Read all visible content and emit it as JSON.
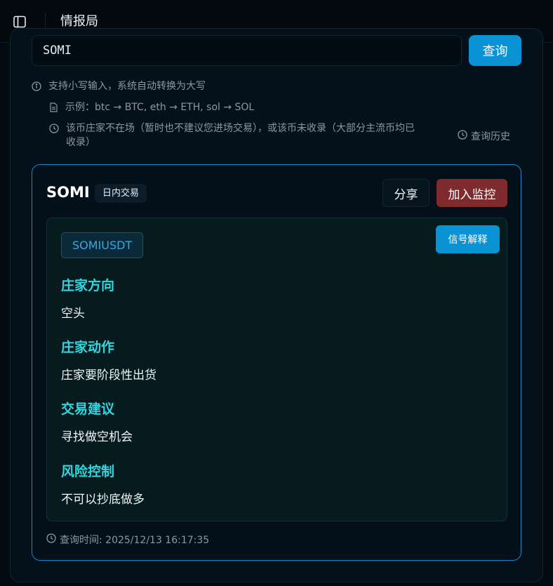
{
  "header": {
    "title": "情报局"
  },
  "search": {
    "value": "SOMI",
    "button_label": "查询"
  },
  "hints": [
    {
      "icon": "info-icon",
      "text": "支持小写输入，系统自动转换为大写"
    },
    {
      "icon": "document-icon",
      "text": "示例：btc → BTC, eth → ETH, sol → SOL"
    },
    {
      "icon": "clock-icon",
      "text_line1": "该币庄家不在场（暂时也不建议您进场交易），或该币未收录（大部分主流币均已",
      "text_line2": "收录）"
    }
  ],
  "history_label": "查询历史",
  "result": {
    "coin": "SOMI",
    "mode_badge": "日内交易",
    "share_label": "分享",
    "monitor_label": "加入监控",
    "pair": "SOMIUSDT",
    "explain_label": "信号解释",
    "sections": [
      {
        "heading": "庄家方向",
        "value": "空头"
      },
      {
        "heading": "庄家动作",
        "value": "庄家要阶段性出货"
      },
      {
        "heading": "交易建议",
        "value": "寻找做空机会"
      },
      {
        "heading": "风险控制",
        "value": "不可以抄底做多"
      }
    ],
    "query_time": "查询时间: 2025/12/13 16:17:35"
  },
  "colors": {
    "accent": "#0a93d4",
    "danger": "#7f2a2c",
    "heading": "#2fd7e0",
    "card_border": "#1a86c6"
  }
}
